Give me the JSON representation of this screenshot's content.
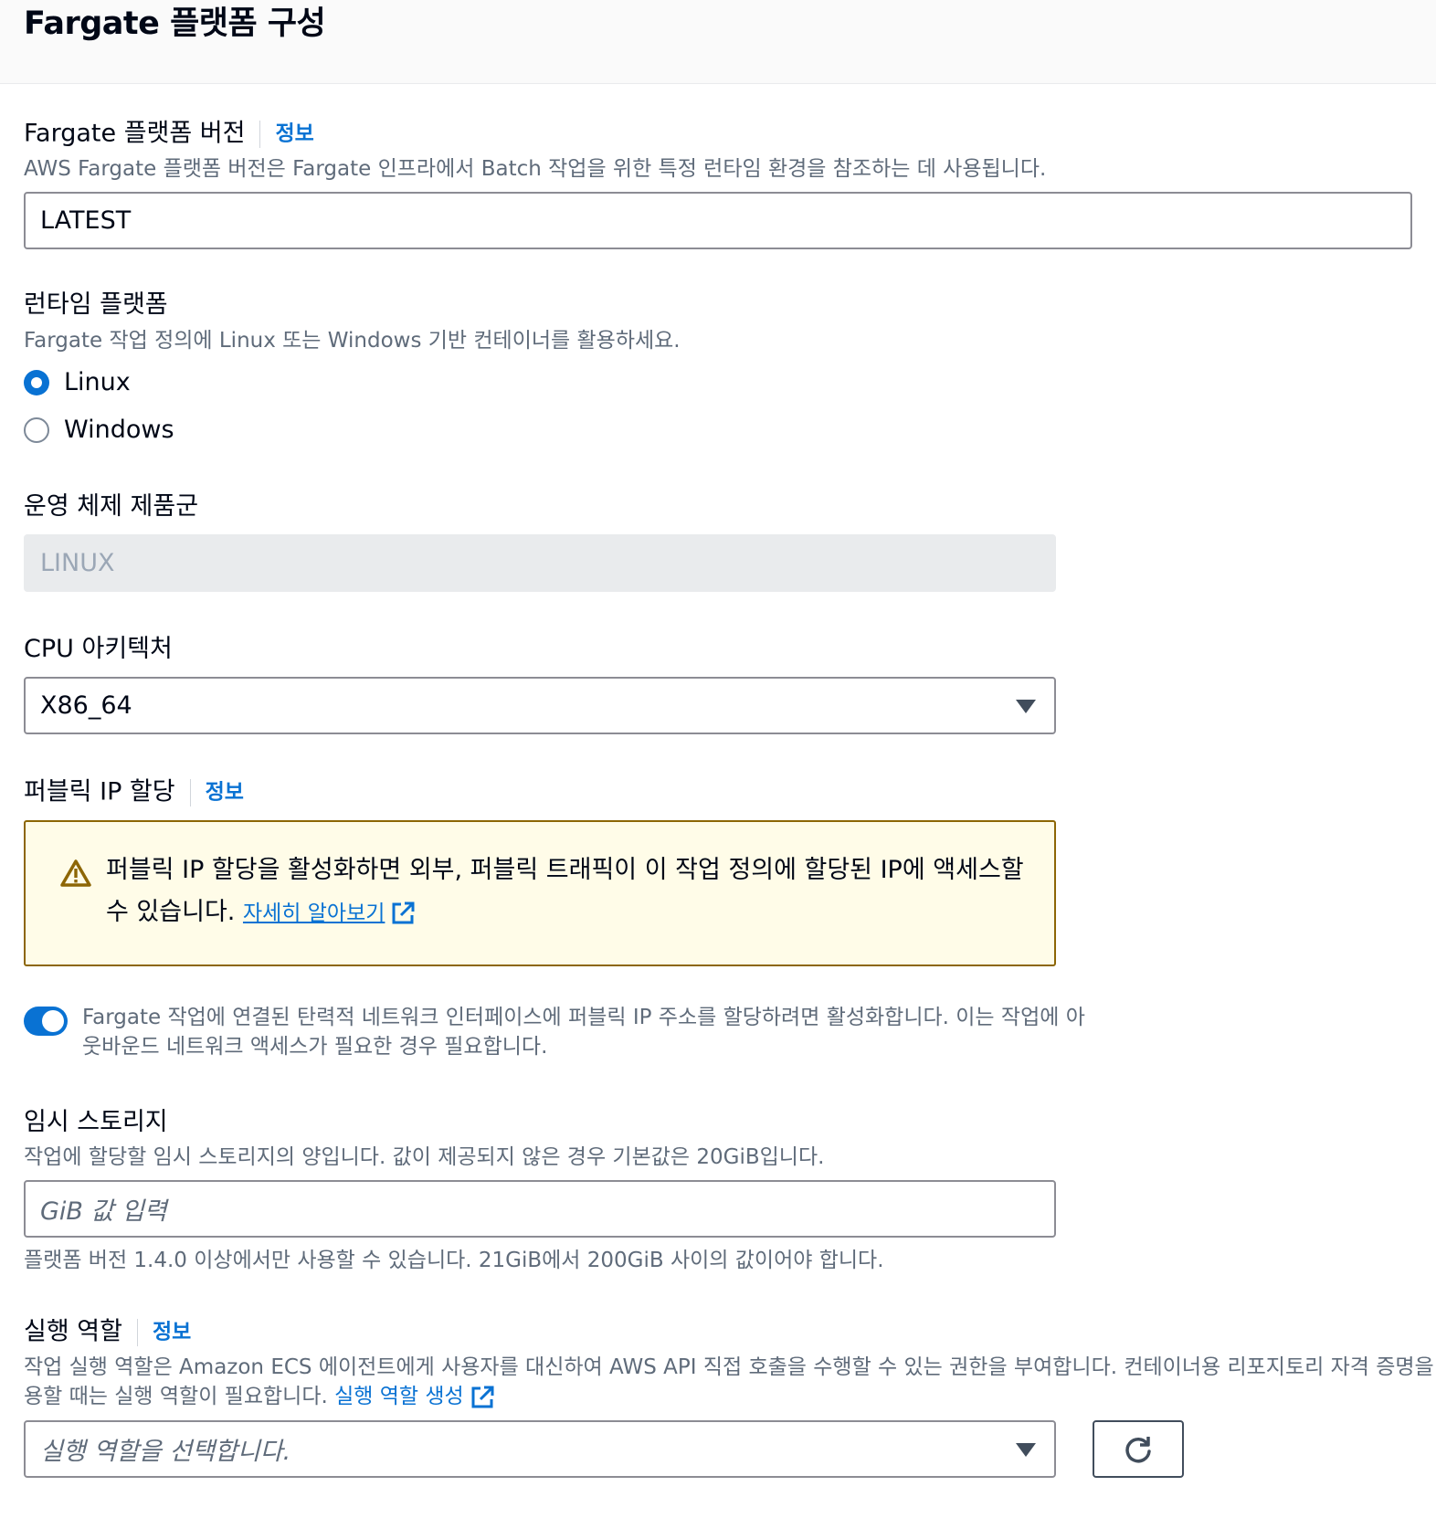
{
  "header": {
    "title": "Fargate 플랫폼 구성"
  },
  "platform_version": {
    "label": "Fargate 플랫폼 버전",
    "info": "정보",
    "description": "AWS Fargate 플랫폼 버전은 Fargate 인프라에서 Batch 작업을 위한 특정 런타임 환경을 참조하는 데 사용됩니다.",
    "value": "LATEST"
  },
  "runtime_platform": {
    "label": "런타임 플랫폼",
    "description": "Fargate 작업 정의에 Linux 또는 Windows 기반 컨테이너를 활용하세요.",
    "options": [
      "Linux",
      "Windows"
    ],
    "selected": "Linux"
  },
  "os_family": {
    "label": "운영 체제 제품군",
    "value": "LINUX"
  },
  "cpu_arch": {
    "label": "CPU 아키텍처",
    "value": "X86_64"
  },
  "public_ip": {
    "label": "퍼블릭 IP 할당",
    "info": "정보",
    "warning_line1": "퍼블릭 IP 할당을 활성화하면 외부, 퍼블릭 트래픽이 이 작업 정의에 할당된 IP에 액세스할",
    "warning_line2": "수 있습니다.",
    "warning_link": "자세히 알아보기",
    "toggle_on": true,
    "toggle_line1": "Fargate 작업에 연결된 탄력적 네트워크 인터페이스에 퍼블릭 IP 주소를 할당하려면 활성화합니다. 이는 작업에 아",
    "toggle_line2": "웃바운드 네트워크 액세스가 필요한 경우 필요합니다."
  },
  "ephemeral_storage": {
    "label": "임시 스토리지",
    "description": "작업에 할당할 임시 스토리지의 양입니다. 값이 제공되지 않은 경우 기본값은 20GiB입니다.",
    "placeholder": "GiB 값 입력",
    "constraint": "플랫폼 버전 1.4.0 이상에서만 사용할 수 있습니다. 21GiB에서 200GiB 사이의 값이어야 합니다."
  },
  "execution_role": {
    "label": "실행 역할",
    "info": "정보",
    "description_line1": "작업 실행 역할은 Amazon ECS 에이전트에게 사용자를 대신하여 AWS API 직접 호출을 수행할 수 있는 권한을 부여합니다. 컨테이너용 리포지토리 자격 증명을 사",
    "description_line2": "용할 때는 실행 역할이 필요합니다.",
    "create_link": "실행 역할 생성",
    "placeholder": "실행 역할을 선택합니다."
  },
  "colors": {
    "accent": "#0972d3",
    "warning_border": "#8d6605",
    "warning_bg": "#fffce8"
  }
}
